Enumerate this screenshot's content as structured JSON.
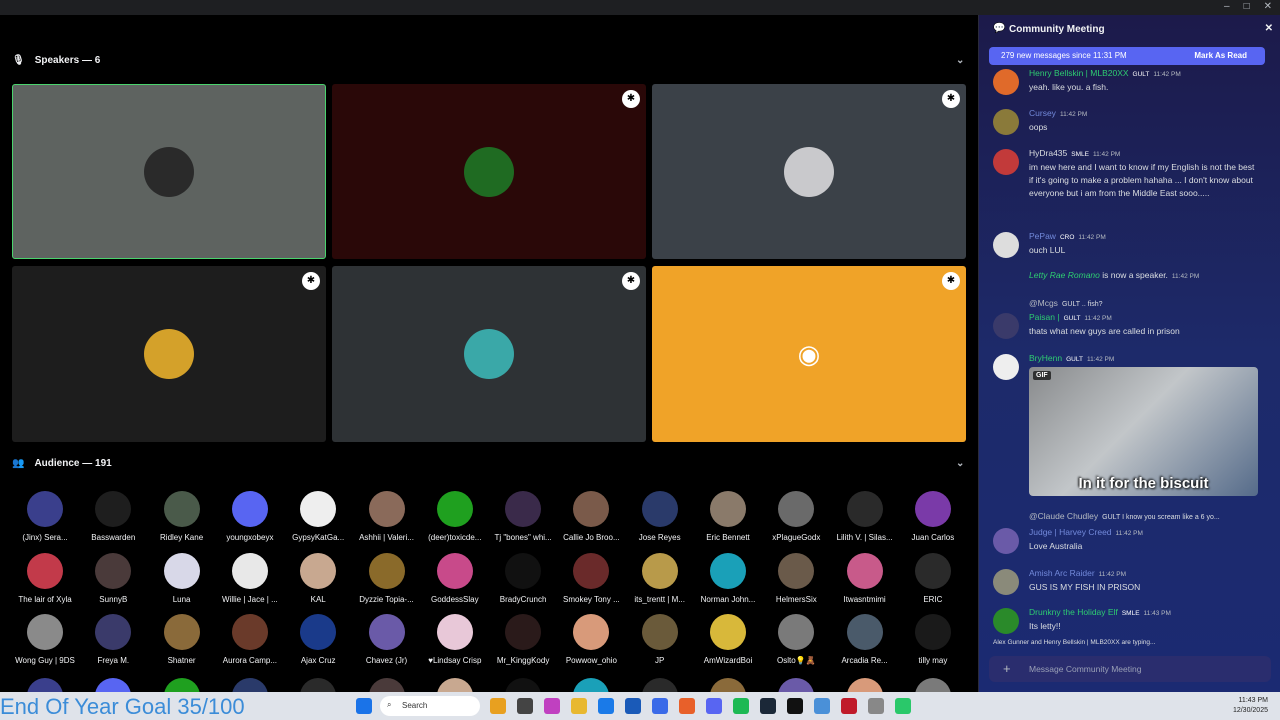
{
  "window": {
    "controls": [
      "–",
      "□",
      "✕"
    ]
  },
  "stage": {
    "speakers_header": "Speakers — 6",
    "audience_header": "Audience — 191",
    "speaker_tiles": [
      {
        "bg": "#5e6360",
        "avatar": "#2a2a2a",
        "border": "#4ad36d",
        "badge": false
      },
      {
        "bg": "#2a0808",
        "avatar": "#1f6b22",
        "badge": true
      },
      {
        "bg": "#3b4148",
        "avatar": "#c9c9cc",
        "badge": true
      },
      {
        "bg": "#1d1d1d",
        "avatar": "#d4a12a",
        "badge": true
      },
      {
        "bg": "#2e3235",
        "avatar": "#3aa8a8",
        "badge": true
      },
      {
        "bg": "#f0a328",
        "avatar": "discord",
        "badge": true
      }
    ],
    "audience": [
      [
        "(Jinx) Sera...",
        "Basswarden",
        "Ridley Kane",
        "youngxobeyx",
        "GypsyKatGa...",
        "Ashhii | Valeri...",
        "(deer)toxicde...",
        "Tj \"bones\" whi...",
        "Callie Jo Broo...",
        "Jose Reyes",
        "Eric Bennett",
        "xPlagueGodx",
        "Lilith V. | Silas...",
        "Juan Carlos"
      ],
      [
        "The lair of Xyla",
        "SunnyB",
        "Luna",
        "Willie | Jace | ...",
        "KAL",
        "Dyzzie Topia-...",
        "GoddessSlay",
        "BradyCrunch",
        "Smokey Tony ...",
        "its_trentt | M...",
        "Norman John...",
        "HelmersSix",
        "Itwasntmimi",
        "ERIC"
      ],
      [
        "Wong Guy | 9DS",
        "Freya M.",
        "Shatner",
        "Aurora Camp...",
        "Ajax Cruz",
        "Chavez (Jr)",
        "♥Lindsay Crisp",
        "Mr_KinggKody",
        "Powwow_ohio",
        "JP",
        "AmWizardBoi",
        "Oslto💡🧸",
        "Arcadia Re...",
        "tilly may"
      ]
    ],
    "audience_colors": [
      "#3a3f8c",
      "#1e1e1e",
      "#4a5a4a",
      "#5865f2",
      "#eeeeee",
      "#8a6a5a",
      "#1fa01f",
      "#3a2a4a",
      "#7a5a4a",
      "#2a3a6a",
      "#8a7a6a",
      "#6a6a6a",
      "#2a2a2a",
      "#7a3aa8",
      "#c23a4a",
      "#4a3a3a",
      "#d8d8e8",
      "#e8e8e8",
      "#c8a890",
      "#8a6a2a",
      "#c84a8a",
      "#111111",
      "#6a2a2a",
      "#b89a4a",
      "#1aa0b8",
      "#6a5a4a",
      "#c85a8a",
      "#2a2a2a",
      "#8a8a8a",
      "#3a3a6a",
      "#8a6a3a",
      "#6a3a2a",
      "#1a3a8a",
      "#6a5aa8",
      "#e8c8d8",
      "#2a1a1a",
      "#d89a7a",
      "#6a5a3a",
      "#d8b83a",
      "#7a7a7a",
      "#4a5a6a",
      "#1a1a1a"
    ]
  },
  "overlay": {
    "goal_text": "End Of Year Goal 35/100"
  },
  "chat": {
    "title": "Community Meeting",
    "banner": "279 new messages since 11:31 PM",
    "mark_read": "Mark As Read",
    "messages": [
      {
        "user": "Henry Bellskin | MLB20XX",
        "tag": "GULT",
        "time": "11:42 PM",
        "text": "yeah. like you. a fish.",
        "color": "#2ecc71",
        "av": "#e06a2a"
      },
      {
        "user": "Cursey",
        "tag": "",
        "time": "11:42 PM",
        "text": "oops",
        "color": "#7289da",
        "av": "#8a7a3a"
      },
      {
        "user": "HyDra435",
        "tag": "SMLE",
        "time": "11:42 PM",
        "text": "im new here and I want to know if my English is not the best if it's going to make a problem hahaha ... I don't know about everyone but i am from the Middle East sooo.....",
        "color": "#dbdee1",
        "av": "#c23a3a"
      },
      {
        "user": "PePaw",
        "tag": "CRO",
        "time": "11:42 PM",
        "text": "ouch LUL",
        "color": "#7289da",
        "av": "#dddddd"
      },
      {
        "user": "Letty Rae Romano",
        "tag": "",
        "time": "11:42 PM",
        "text": "is now a speaker.",
        "color": "#2ecc71",
        "av": ""
      },
      {
        "user": "@Mcgs",
        "tag": "GULT",
        "time": "",
        "text": ".. fish?",
        "color": "#b5bac1",
        "av": ""
      },
      {
        "user": "Paisan |",
        "tag": "GULT",
        "time": "11:42 PM",
        "text": "thats what new guys are called in prison",
        "color": "#2ecc71",
        "av": "#3a3a6a"
      },
      {
        "user": "BryHenn",
        "tag": "GULT",
        "time": "11:42 PM",
        "text": "",
        "color": "#2ecc71",
        "av": "#eeeeee"
      },
      {
        "user": "@Claude Chudley",
        "tag": "GULT",
        "time": "",
        "text": "I know you scream like a 6 yo...",
        "color": "#b5bac1",
        "av": ""
      },
      {
        "user": "Judge | Harvey Creed",
        "tag": "",
        "time": "11:42 PM",
        "text": "Love Australia",
        "color": "#7289da",
        "av": "#6a5aa8"
      },
      {
        "user": "Amish Arc Raider",
        "tag": "",
        "time": "11:42 PM",
        "text": "GUS IS MY FISH IN PRISON",
        "color": "#7289da",
        "av": "#8a8a7a"
      },
      {
        "user": "Drunkny the Holiday Elf",
        "tag": "SMLE",
        "time": "11:43 PM",
        "text": "Its letty!!",
        "color": "#2ecc71",
        "av": "#2a8a2a"
      }
    ],
    "gif_label": "GIF",
    "gif_caption": "In it for the biscuit",
    "typing": "Alex Gunner and Henry Bellskin | MLB20XX are typing...",
    "input_placeholder": "Message Community Meeting"
  },
  "taskbar": {
    "search": "Search",
    "time": "11:43 PM",
    "date": "12/30/2025"
  }
}
